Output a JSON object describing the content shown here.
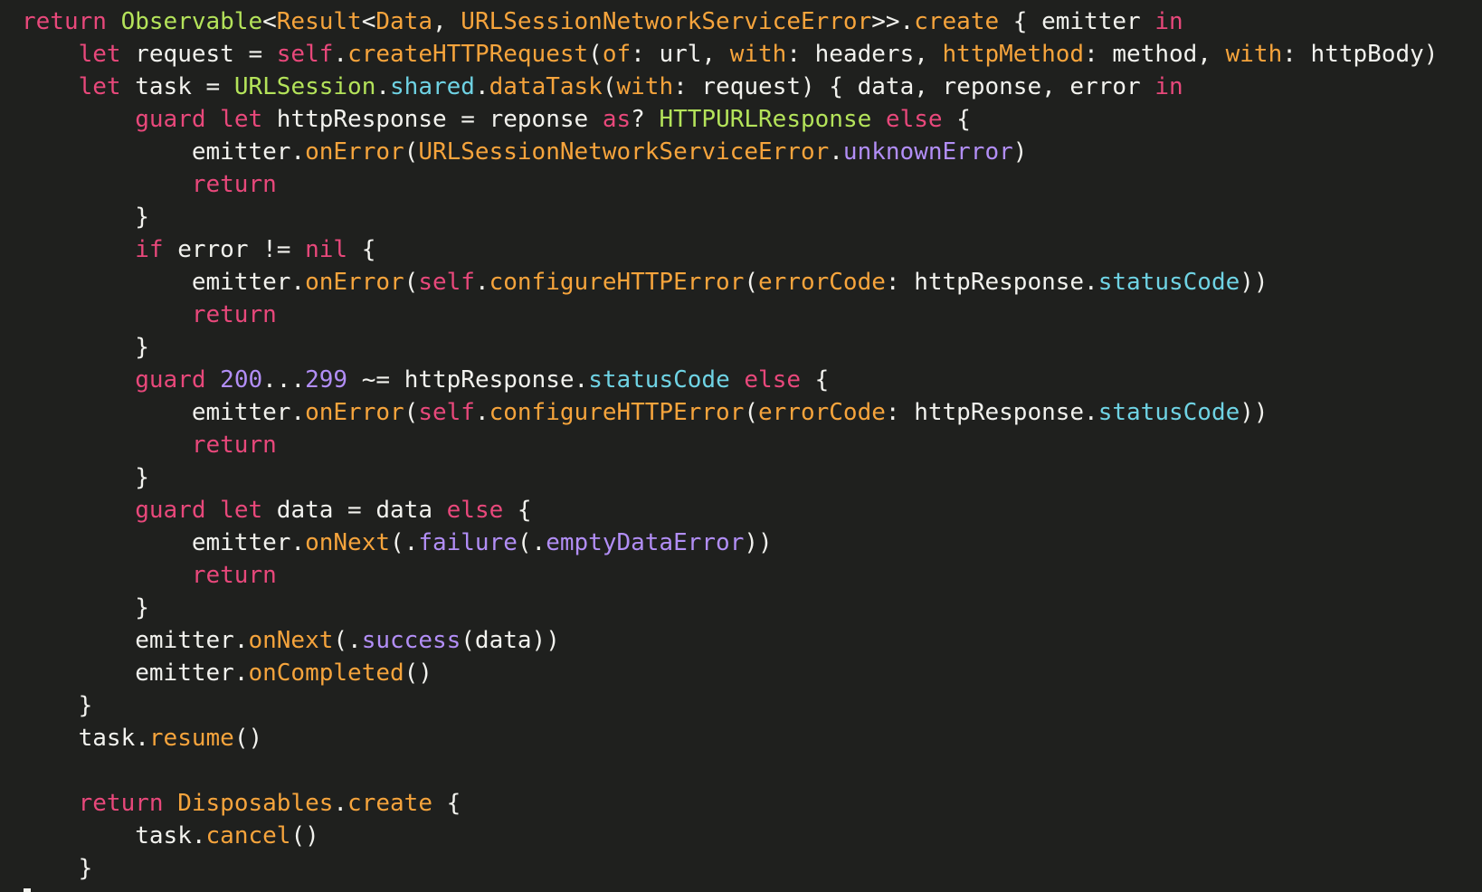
{
  "colors": {
    "background": "#1f201e",
    "plain": "#f2f2ee",
    "keyword": "#e8487b",
    "type": "#b4e35a",
    "function": "#f6a43c",
    "property": "#6fd3e4",
    "enum_case": "#b28ef6",
    "number": "#b28ef6"
  },
  "code_lines": [
    {
      "indent": 0,
      "tokens": [
        {
          "t": "kw",
          "v": "return"
        },
        {
          "t": "pl",
          "v": " "
        },
        {
          "t": "ty",
          "v": "Observable"
        },
        {
          "t": "pl",
          "v": "<"
        },
        {
          "t": "fn",
          "v": "Result"
        },
        {
          "t": "pl",
          "v": "<"
        },
        {
          "t": "fn",
          "v": "Data"
        },
        {
          "t": "pl",
          "v": ", "
        },
        {
          "t": "fn",
          "v": "URLSessionNetworkServiceError"
        },
        {
          "t": "pl",
          "v": ">>."
        },
        {
          "t": "fn",
          "v": "create"
        },
        {
          "t": "pl",
          "v": " { emitter "
        },
        {
          "t": "kw",
          "v": "in"
        }
      ]
    },
    {
      "indent": 1,
      "tokens": [
        {
          "t": "kw",
          "v": "let"
        },
        {
          "t": "pl",
          "v": " request = "
        },
        {
          "t": "kw",
          "v": "self"
        },
        {
          "t": "pl",
          "v": "."
        },
        {
          "t": "fn",
          "v": "createHTTPRequest"
        },
        {
          "t": "pl",
          "v": "("
        },
        {
          "t": "fn",
          "v": "of"
        },
        {
          "t": "pl",
          "v": ": url, "
        },
        {
          "t": "fn",
          "v": "with"
        },
        {
          "t": "pl",
          "v": ": headers, "
        },
        {
          "t": "fn",
          "v": "httpMethod"
        },
        {
          "t": "pl",
          "v": ": method, "
        },
        {
          "t": "fn",
          "v": "with"
        },
        {
          "t": "pl",
          "v": ": httpBody)"
        }
      ]
    },
    {
      "indent": 1,
      "tokens": [
        {
          "t": "kw",
          "v": "let"
        },
        {
          "t": "pl",
          "v": " task = "
        },
        {
          "t": "ty",
          "v": "URLSession"
        },
        {
          "t": "pl",
          "v": "."
        },
        {
          "t": "pr",
          "v": "shared"
        },
        {
          "t": "pl",
          "v": "."
        },
        {
          "t": "fn",
          "v": "dataTask"
        },
        {
          "t": "pl",
          "v": "("
        },
        {
          "t": "fn",
          "v": "with"
        },
        {
          "t": "pl",
          "v": ": request) { data, reponse, error "
        },
        {
          "t": "kw",
          "v": "in"
        }
      ]
    },
    {
      "indent": 2,
      "tokens": [
        {
          "t": "kw",
          "v": "guard"
        },
        {
          "t": "pl",
          "v": " "
        },
        {
          "t": "kw",
          "v": "let"
        },
        {
          "t": "pl",
          "v": " httpResponse = reponse "
        },
        {
          "t": "kw",
          "v": "as"
        },
        {
          "t": "pl",
          "v": "? "
        },
        {
          "t": "ty",
          "v": "HTTPURLResponse"
        },
        {
          "t": "pl",
          "v": " "
        },
        {
          "t": "kw",
          "v": "else"
        },
        {
          "t": "pl",
          "v": " {"
        }
      ]
    },
    {
      "indent": 3,
      "tokens": [
        {
          "t": "pl",
          "v": "emitter."
        },
        {
          "t": "fn",
          "v": "onError"
        },
        {
          "t": "pl",
          "v": "("
        },
        {
          "t": "fn",
          "v": "URLSessionNetworkServiceError"
        },
        {
          "t": "pl",
          "v": "."
        },
        {
          "t": "en",
          "v": "unknownError"
        },
        {
          "t": "pl",
          "v": ")"
        }
      ]
    },
    {
      "indent": 3,
      "tokens": [
        {
          "t": "kw",
          "v": "return"
        }
      ]
    },
    {
      "indent": 2,
      "tokens": [
        {
          "t": "pl",
          "v": "}"
        }
      ]
    },
    {
      "indent": 2,
      "tokens": [
        {
          "t": "kw",
          "v": "if"
        },
        {
          "t": "pl",
          "v": " error != "
        },
        {
          "t": "kw",
          "v": "nil"
        },
        {
          "t": "pl",
          "v": " {"
        }
      ]
    },
    {
      "indent": 3,
      "tokens": [
        {
          "t": "pl",
          "v": "emitter."
        },
        {
          "t": "fn",
          "v": "onError"
        },
        {
          "t": "pl",
          "v": "("
        },
        {
          "t": "kw",
          "v": "self"
        },
        {
          "t": "pl",
          "v": "."
        },
        {
          "t": "fn",
          "v": "configureHTTPError"
        },
        {
          "t": "pl",
          "v": "("
        },
        {
          "t": "fn",
          "v": "errorCode"
        },
        {
          "t": "pl",
          "v": ": httpResponse."
        },
        {
          "t": "pr",
          "v": "statusCode"
        },
        {
          "t": "pl",
          "v": "))"
        }
      ]
    },
    {
      "indent": 3,
      "tokens": [
        {
          "t": "kw",
          "v": "return"
        }
      ]
    },
    {
      "indent": 2,
      "tokens": [
        {
          "t": "pl",
          "v": "}"
        }
      ]
    },
    {
      "indent": 2,
      "tokens": [
        {
          "t": "kw",
          "v": "guard"
        },
        {
          "t": "pl",
          "v": " "
        },
        {
          "t": "nm",
          "v": "200"
        },
        {
          "t": "pl",
          "v": "..."
        },
        {
          "t": "nm",
          "v": "299"
        },
        {
          "t": "pl",
          "v": " ~= httpResponse."
        },
        {
          "t": "pr",
          "v": "statusCode"
        },
        {
          "t": "pl",
          "v": " "
        },
        {
          "t": "kw",
          "v": "else"
        },
        {
          "t": "pl",
          "v": " {"
        }
      ]
    },
    {
      "indent": 3,
      "tokens": [
        {
          "t": "pl",
          "v": "emitter."
        },
        {
          "t": "fn",
          "v": "onError"
        },
        {
          "t": "pl",
          "v": "("
        },
        {
          "t": "kw",
          "v": "self"
        },
        {
          "t": "pl",
          "v": "."
        },
        {
          "t": "fn",
          "v": "configureHTTPError"
        },
        {
          "t": "pl",
          "v": "("
        },
        {
          "t": "fn",
          "v": "errorCode"
        },
        {
          "t": "pl",
          "v": ": httpResponse."
        },
        {
          "t": "pr",
          "v": "statusCode"
        },
        {
          "t": "pl",
          "v": "))"
        }
      ]
    },
    {
      "indent": 3,
      "tokens": [
        {
          "t": "kw",
          "v": "return"
        }
      ]
    },
    {
      "indent": 2,
      "tokens": [
        {
          "t": "pl",
          "v": "}"
        }
      ]
    },
    {
      "indent": 2,
      "tokens": [
        {
          "t": "kw",
          "v": "guard"
        },
        {
          "t": "pl",
          "v": " "
        },
        {
          "t": "kw",
          "v": "let"
        },
        {
          "t": "pl",
          "v": " data = data "
        },
        {
          "t": "kw",
          "v": "else"
        },
        {
          "t": "pl",
          "v": " {"
        }
      ]
    },
    {
      "indent": 3,
      "tokens": [
        {
          "t": "pl",
          "v": "emitter."
        },
        {
          "t": "fn",
          "v": "onNext"
        },
        {
          "t": "pl",
          "v": "(."
        },
        {
          "t": "en",
          "v": "failure"
        },
        {
          "t": "pl",
          "v": "(."
        },
        {
          "t": "en",
          "v": "emptyDataError"
        },
        {
          "t": "pl",
          "v": "))"
        }
      ]
    },
    {
      "indent": 3,
      "tokens": [
        {
          "t": "kw",
          "v": "return"
        }
      ]
    },
    {
      "indent": 2,
      "tokens": [
        {
          "t": "pl",
          "v": "}"
        }
      ]
    },
    {
      "indent": 2,
      "tokens": [
        {
          "t": "pl",
          "v": "emitter."
        },
        {
          "t": "fn",
          "v": "onNext"
        },
        {
          "t": "pl",
          "v": "(."
        },
        {
          "t": "en",
          "v": "success"
        },
        {
          "t": "pl",
          "v": "(data))"
        }
      ]
    },
    {
      "indent": 2,
      "tokens": [
        {
          "t": "pl",
          "v": "emitter."
        },
        {
          "t": "fn",
          "v": "onCompleted"
        },
        {
          "t": "pl",
          "v": "()"
        }
      ]
    },
    {
      "indent": 1,
      "tokens": [
        {
          "t": "pl",
          "v": "}"
        }
      ]
    },
    {
      "indent": 1,
      "tokens": [
        {
          "t": "pl",
          "v": "task."
        },
        {
          "t": "fn",
          "v": "resume"
        },
        {
          "t": "pl",
          "v": "()"
        }
      ]
    },
    {
      "indent": 0,
      "tokens": []
    },
    {
      "indent": 1,
      "tokens": [
        {
          "t": "kw",
          "v": "return"
        },
        {
          "t": "pl",
          "v": " "
        },
        {
          "t": "fn",
          "v": "Disposables"
        },
        {
          "t": "pl",
          "v": "."
        },
        {
          "t": "fn",
          "v": "create"
        },
        {
          "t": "pl",
          "v": " {"
        }
      ]
    },
    {
      "indent": 2,
      "tokens": [
        {
          "t": "pl",
          "v": "task."
        },
        {
          "t": "fn",
          "v": "cancel"
        },
        {
          "t": "pl",
          "v": "()"
        }
      ]
    },
    {
      "indent": 1,
      "tokens": [
        {
          "t": "pl",
          "v": "}"
        }
      ]
    }
  ]
}
